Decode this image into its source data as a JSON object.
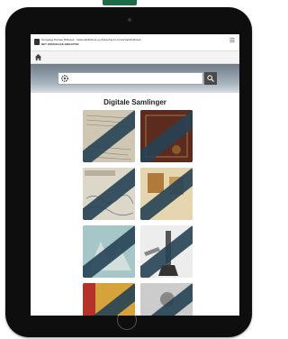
{
  "site": {
    "logo_line1": "Kongelige Danske Bibliotek · Nationalbibliotek og Københavns Universitetsbibliotek",
    "logo_line2": "DET KONGELIGE BIBLIOTEK"
  },
  "search": {
    "placeholder": "",
    "value": ""
  },
  "page": {
    "title": "Digitale Samlinger"
  },
  "tiles": [
    {
      "label": "",
      "sub": ""
    },
    {
      "label": "",
      "sub": ""
    },
    {
      "label": "",
      "sub": ""
    },
    {
      "label": "",
      "sub": ""
    },
    {
      "label": "",
      "sub": ""
    },
    {
      "label": "",
      "sub": ""
    },
    {
      "label": "",
      "sub": ""
    },
    {
      "label": "",
      "sub": ""
    }
  ],
  "colors": {
    "frame": "#0e0e0e",
    "banner": "#264254",
    "top_tab": "#1f6b47",
    "search_button": "#4a4a4a"
  },
  "icons": [
    "home-icon",
    "gear-icon",
    "search-icon",
    "menu-icon"
  ]
}
